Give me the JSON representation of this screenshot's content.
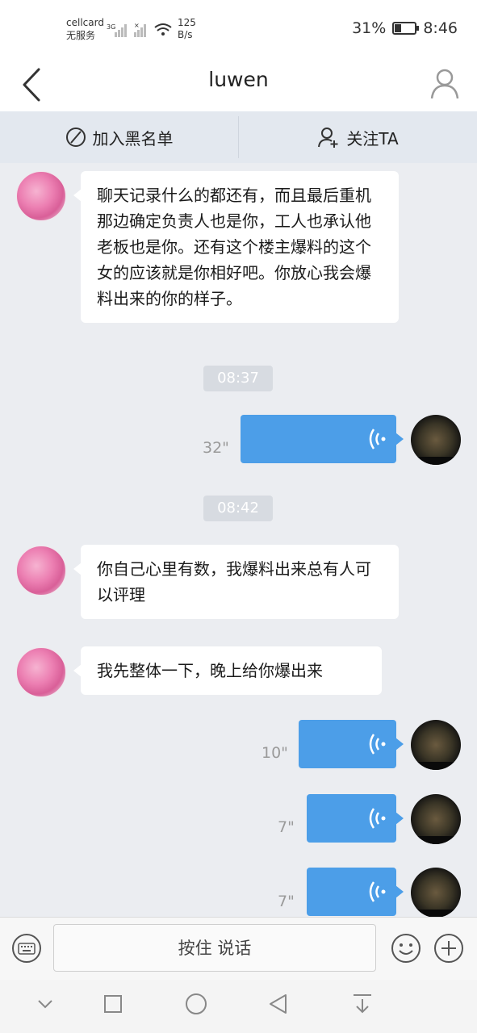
{
  "status_bar": {
    "carrier": "cellcard",
    "service": "无服务",
    "signal": "3G",
    "net_speed_value": "125",
    "net_speed_unit": "B/s",
    "battery": "31%",
    "battery_level": 0.31,
    "time": "8:46"
  },
  "header": {
    "title": "luwen",
    "back_icon": "chevron-left-icon",
    "profile_icon": "person-icon"
  },
  "actions": {
    "blacklist_label": "加入黑名单",
    "follow_label": "关注TA"
  },
  "messages": [
    {
      "type": "text",
      "side": "left",
      "text": "聊天记录什么的都还有，而且最后重机那边确定负责人也是你，工人也承认他老板也是你。还有这个楼主爆料的这个女的应该就是你相好吧。你放心我会爆料出来的你的样子。"
    },
    {
      "type": "time",
      "text": "08:37"
    },
    {
      "type": "voice",
      "side": "right",
      "duration": "32\""
    },
    {
      "type": "time",
      "text": "08:42"
    },
    {
      "type": "text",
      "side": "left",
      "text": "你自己心里有数，我爆料出来总有人可以评理"
    },
    {
      "type": "text",
      "side": "left",
      "text": "我先整体一下，晚上给你爆出来"
    },
    {
      "type": "voice",
      "side": "right",
      "duration": "10\""
    },
    {
      "type": "voice",
      "side": "right",
      "duration": "7\""
    },
    {
      "type": "voice",
      "side": "right",
      "duration": "7\""
    }
  ],
  "input_bar": {
    "talk_label": "按住  说话",
    "keyboard_icon": "keyboard-icon",
    "emoji_icon": "emoji-icon",
    "plus_icon": "plus-icon"
  },
  "nav_bar": {
    "icons": [
      "chevron-down-icon",
      "square-icon",
      "circle-icon",
      "triangle-back-icon",
      "download-icon"
    ]
  }
}
